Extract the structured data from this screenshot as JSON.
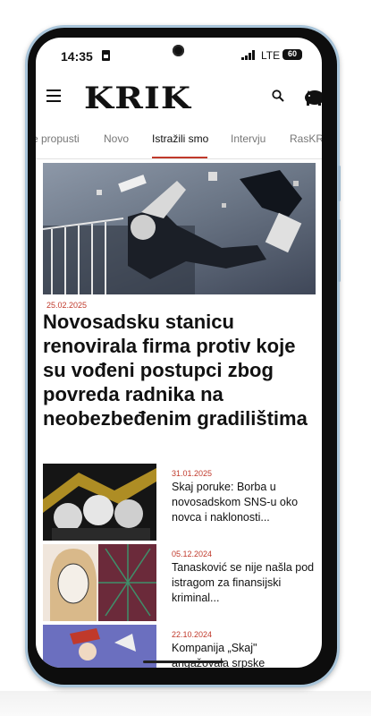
{
  "status_bar": {
    "time": "14:35",
    "network": "LTE",
    "battery": "60"
  },
  "header": {
    "logo": "KRIK"
  },
  "tabs": [
    {
      "label": "e propusti",
      "active": false
    },
    {
      "label": "Novo",
      "active": false
    },
    {
      "label": "Istražili smo",
      "active": true
    },
    {
      "label": "Intervju",
      "active": false
    },
    {
      "label": "RasKRI",
      "active": false
    }
  ],
  "hero": {
    "date": "25.02.2025",
    "title": "Novosadsku stanicu renovirala firma protiv koje su vođeni postupci zbog povreda radnika na neobezbeđenim gradilištima"
  },
  "articles": [
    {
      "date": "31.01.2025",
      "title": "Skaj poruke: Borba u novosadskom SNS-u oko novca i naklonosti..."
    },
    {
      "date": "05.12.2024",
      "title": "Tanasković se nije našla pod istragom za finansijski kriminal..."
    },
    {
      "date": "22.10.2024",
      "title": "Kompanija „Skaj\" angažovala srpske"
    }
  ],
  "colors": {
    "accent": "#c0392b",
    "frame": "#a9c5da"
  }
}
